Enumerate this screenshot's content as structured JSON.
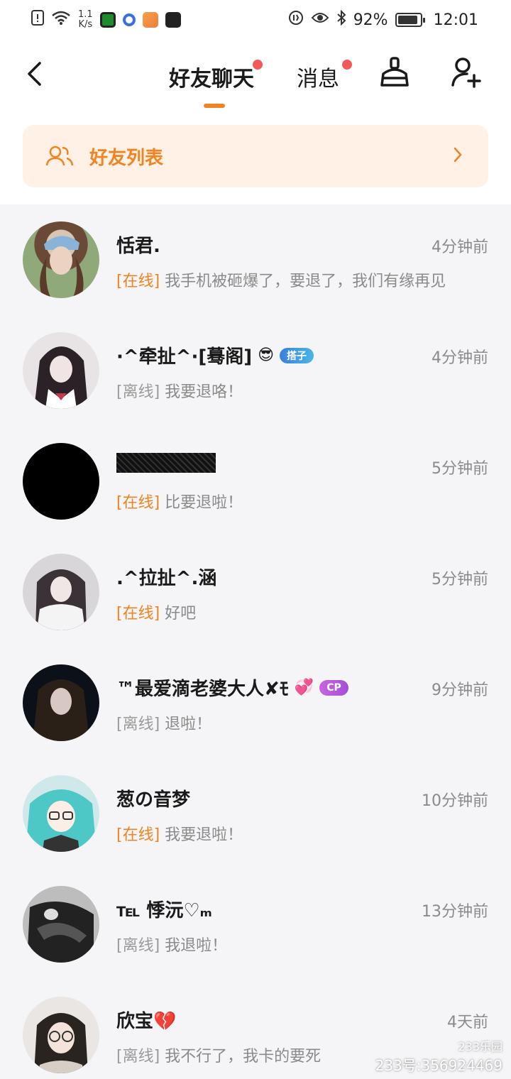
{
  "status_bar": {
    "speed_value": "1.1",
    "speed_unit": "K/s",
    "battery": "92%",
    "battery_level": 0.92,
    "time": "12:01"
  },
  "header": {
    "tabs": [
      {
        "label": "好友聊天",
        "active": true,
        "has_dot": true
      },
      {
        "label": "消息",
        "active": false,
        "has_dot": true
      }
    ],
    "icons": [
      "back-arrow-icon",
      "clean-broom-icon",
      "add-friend-icon"
    ],
    "accent_color": "#f28322"
  },
  "friend_list_bar": {
    "label": "好友列表"
  },
  "chats": [
    {
      "name": "恬君.",
      "time": "4分钟前",
      "status": "[在线]",
      "online": true,
      "message": "我手机被砸爆了，要退了，我们有缘再见"
    },
    {
      "name": "·^牵扯^·[蓦阁]",
      "time": "4分钟前",
      "status": "[离线]",
      "online": false,
      "message": "我要退咯！",
      "badge": "搭子"
    },
    {
      "name": "",
      "time": "5分钟前",
      "status": "[在线]",
      "online": true,
      "message": "比要退啦！",
      "redacted": true
    },
    {
      "name": ".^拉扯^.涵",
      "time": "5分钟前",
      "status": "[在线]",
      "online": true,
      "message": "好吧"
    },
    {
      "name": "™最爱滴老婆大人✘ﾓ",
      "time": "9分钟前",
      "status": "[离线]",
      "online": false,
      "message": "退啦！",
      "badge": "CP"
    },
    {
      "name": "葱の音梦",
      "time": "10分钟前",
      "status": "[在线]",
      "online": true,
      "message": "我要退啦！"
    },
    {
      "name": "℡ 悸沅♡ₘ",
      "time": "13分钟前",
      "status": "[离线]",
      "online": false,
      "message": "我退啦！"
    },
    {
      "name": "欣宝💔",
      "time": "4天前",
      "status": "[离线]",
      "online": false,
      "message": "我不行了，我卡的要死"
    }
  ],
  "watermark": {
    "logo": "233乐园",
    "id": "233号:356924469"
  }
}
